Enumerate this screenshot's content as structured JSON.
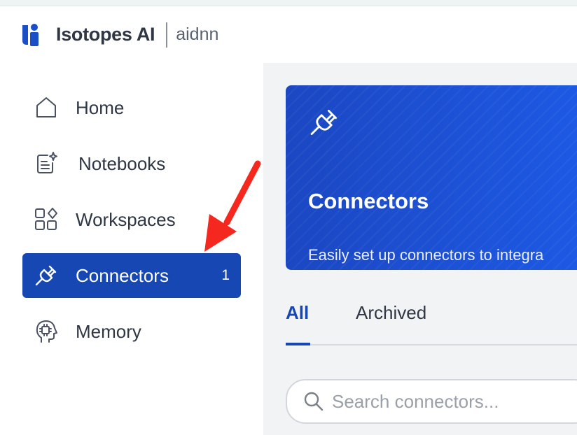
{
  "header": {
    "brand": "Isotopes AI",
    "product": "aidnn"
  },
  "sidebar": {
    "items": [
      {
        "label": "Home",
        "icon": "home-icon"
      },
      {
        "label": "Notebooks",
        "icon": "notebook-icon"
      },
      {
        "label": "Workspaces",
        "icon": "workspaces-icon"
      },
      {
        "label": "Connectors",
        "icon": "plug-icon",
        "count": "1",
        "active": true
      },
      {
        "label": "Memory",
        "icon": "brain-head-icon"
      }
    ]
  },
  "hero": {
    "icon": "plug-icon",
    "title": "Connectors",
    "description": "Easily set up connectors to integra"
  },
  "tabs": [
    {
      "label": "All",
      "active": true
    },
    {
      "label": "Archived",
      "active": false
    }
  ],
  "search": {
    "placeholder": "Search connectors..."
  },
  "colors": {
    "accent": "#1747b3",
    "hero": "#1d53d6",
    "arrow": "#f5281f",
    "background": "#f2f3f5"
  }
}
